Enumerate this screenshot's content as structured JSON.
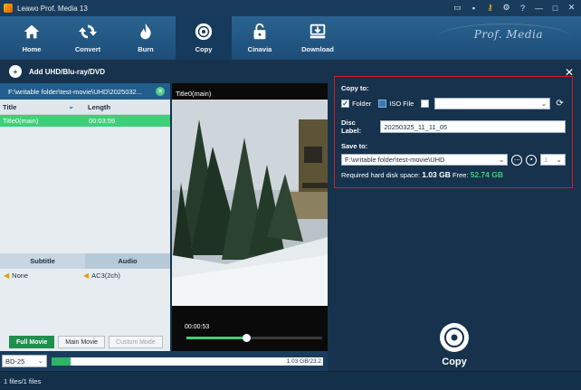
{
  "window": {
    "title": "Leawo Prof. Media 13"
  },
  "nav": {
    "items": [
      {
        "label": "Home",
        "icon": "home-icon"
      },
      {
        "label": "Convert",
        "icon": "convert-icon"
      },
      {
        "label": "Burn",
        "icon": "burn-icon"
      },
      {
        "label": "Copy",
        "icon": "copy-disc-icon",
        "active": true
      },
      {
        "label": "Cinavia",
        "icon": "cinavia-lock-icon"
      },
      {
        "label": "Download",
        "icon": "download-icon"
      }
    ],
    "brand": "Prof. Media"
  },
  "add_source": {
    "label": "Add UHD/Blu-ray/DVD"
  },
  "source": {
    "path": "F:\\writable folder\\test-movie\\UHD\\2025032...",
    "columns": {
      "title": "Title",
      "length": "Length"
    },
    "titles": [
      {
        "title": "Title0(main)",
        "length": "00:03:59"
      }
    ],
    "subtitle_header": "Subtitle",
    "audio_header": "Audio",
    "subtitle_value": "None",
    "audio_value": "AC3(2ch)"
  },
  "modes": {
    "full": "Full Movie",
    "main": "Main Movie",
    "custom": "Custom Mode"
  },
  "player": {
    "title": "Title0(main)",
    "time": "00:00:53",
    "position": 0.44
  },
  "copy_settings": {
    "copy_to_label": "Copy to:",
    "folder_label": "Folder",
    "iso_label": "ISO File",
    "disc_label_label": "Disc Label:",
    "disc_label_value": "20250325_11_11_05",
    "save_to_label": "Save to:",
    "save_to_value": "F:\\writable folder\\test-movie\\UHD",
    "copies_value": "1",
    "required_label": "Required hard disk space:",
    "required_value": "1.03 GB",
    "free_label": "Free:",
    "free_value": "52.74 GB"
  },
  "copy_button": {
    "label": "Copy"
  },
  "disc_type": {
    "value": "BD-25"
  },
  "capacity": {
    "text": "1.03 GB/23.2",
    "fraction": 0.07
  },
  "status": {
    "text": "1 files/1 files"
  },
  "colors": {
    "accent_green": "#3fcf78",
    "highlight_red": "#d21d1d",
    "toolbar_blue": "#1d4d78"
  }
}
